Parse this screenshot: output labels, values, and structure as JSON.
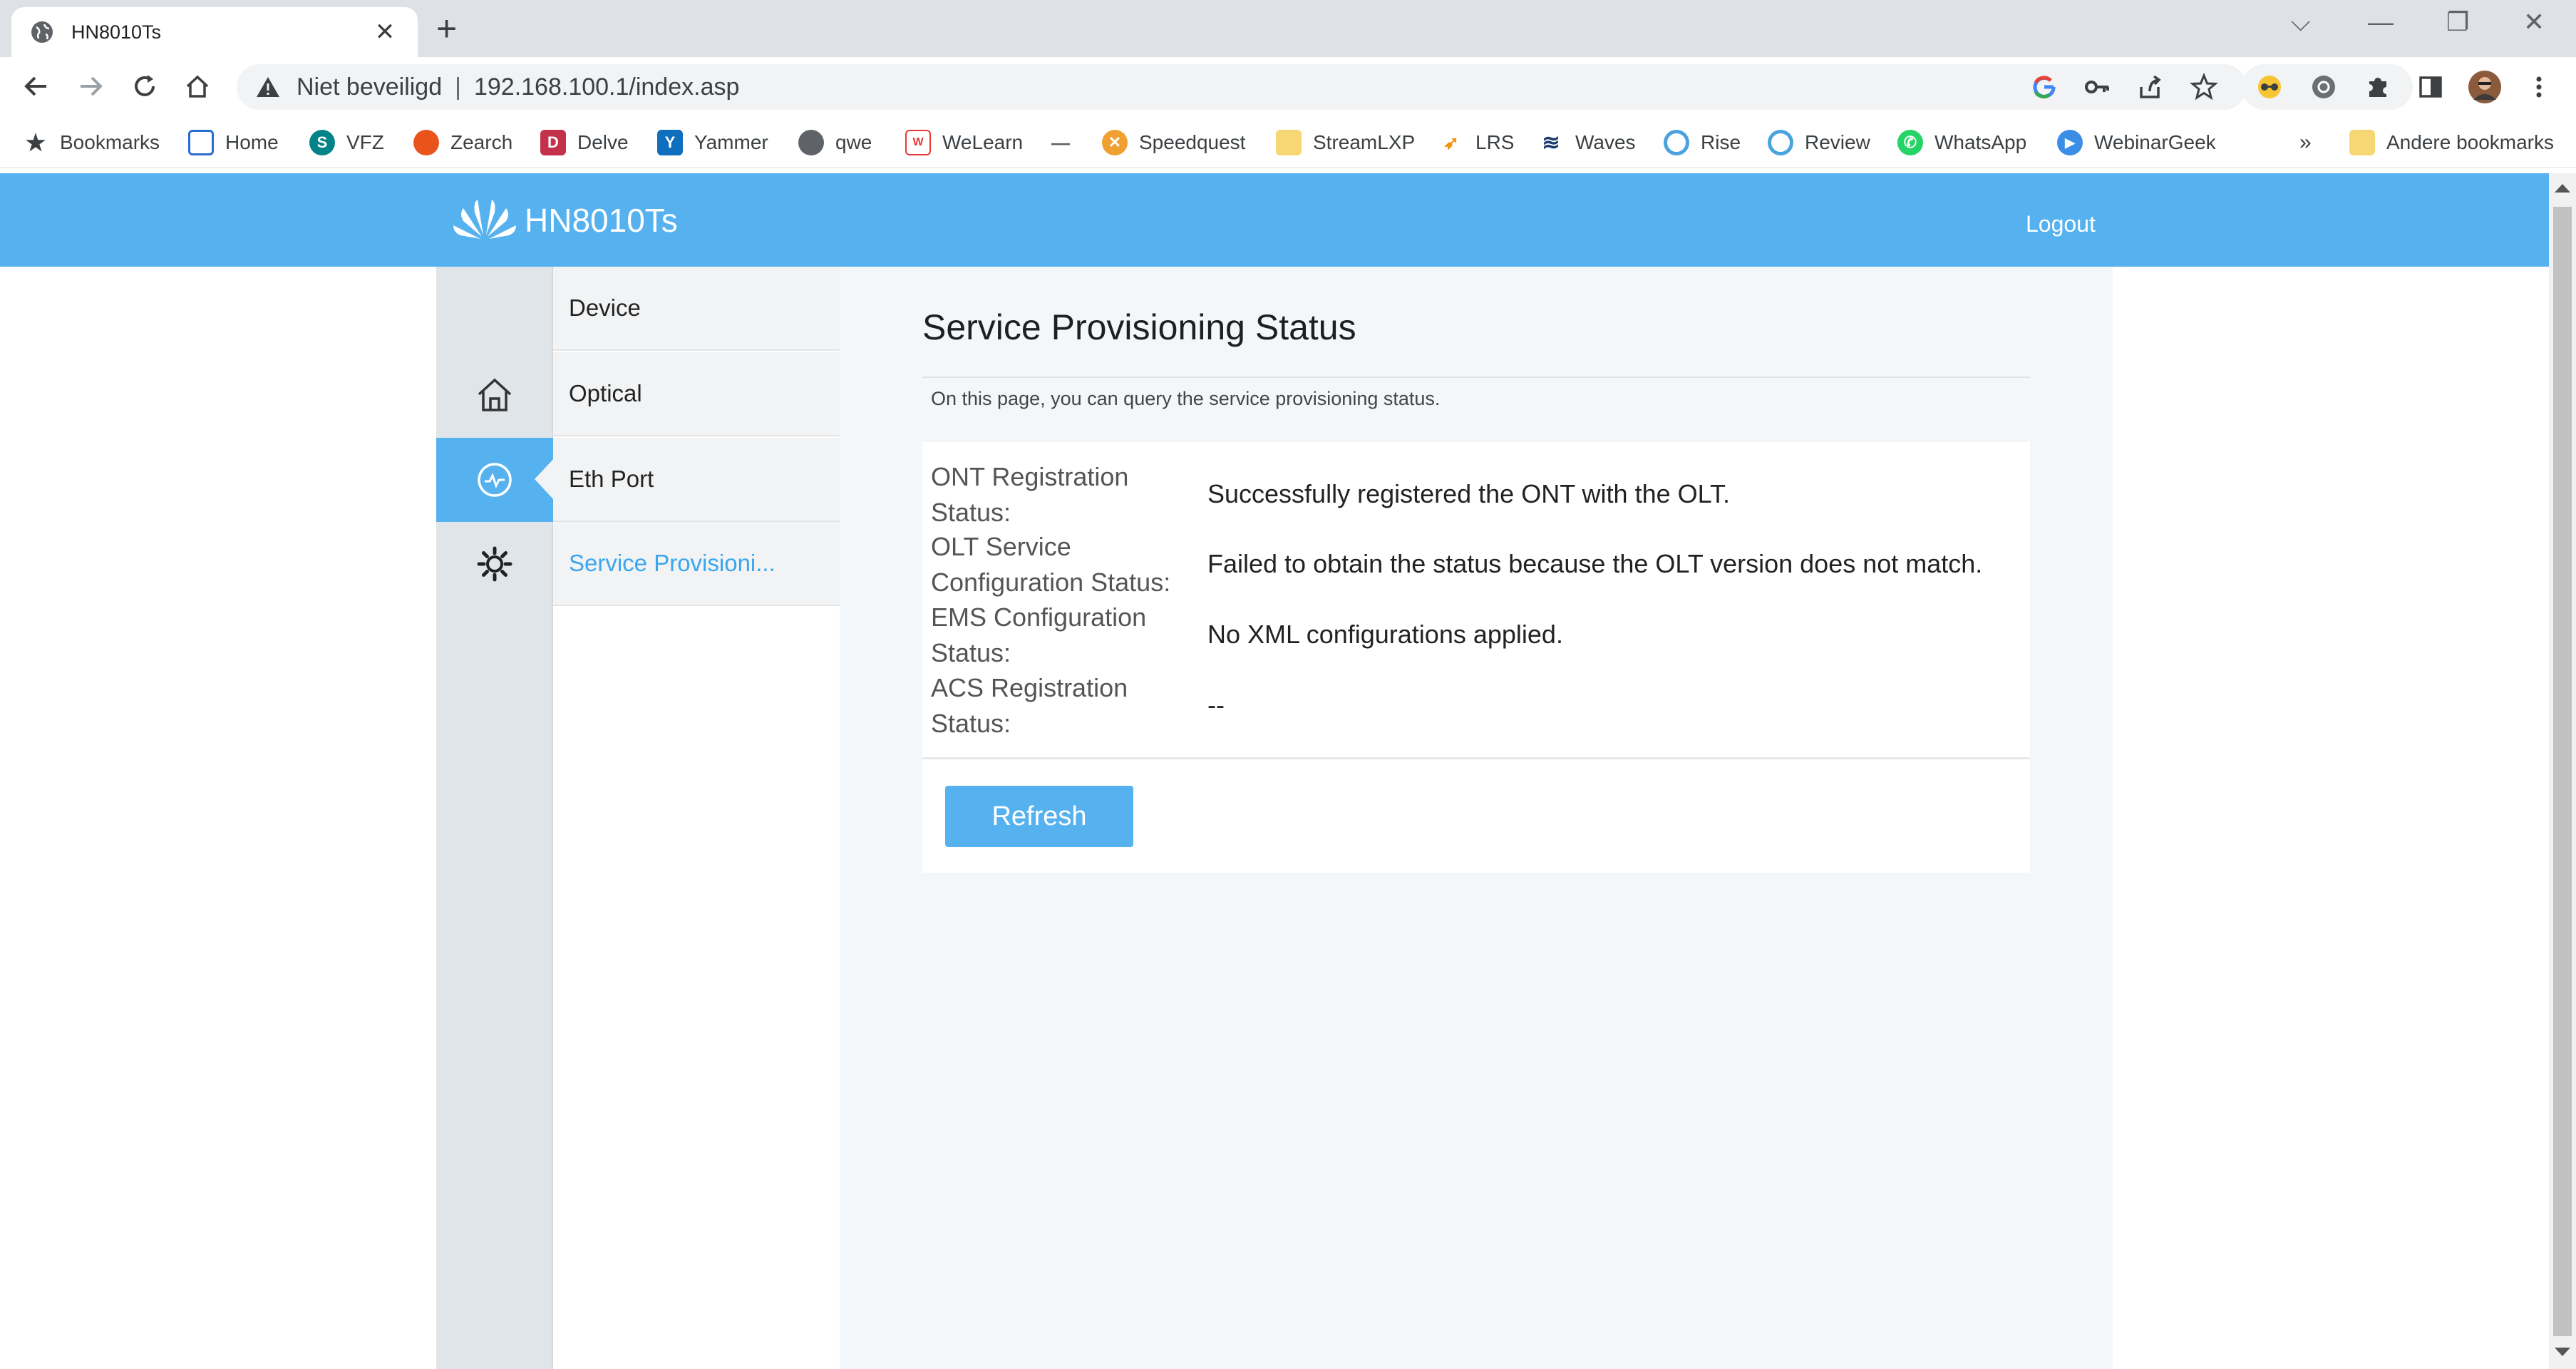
{
  "browser": {
    "tab_title": "HN8010Ts",
    "new_tab_label": "+",
    "address": {
      "security_text": "Niet beveiligd",
      "separator": "|",
      "url": "192.168.100.1/index.asp"
    },
    "bookmarks": [
      {
        "label": "Bookmarks",
        "icon": "star-icon"
      },
      {
        "label": "Home",
        "icon": "home-grid-icon"
      },
      {
        "label": "VFZ",
        "icon": "sharepoint-icon"
      },
      {
        "label": "Zearch",
        "icon": "zearch-icon"
      },
      {
        "label": "Delve",
        "icon": "delve-icon"
      },
      {
        "label": "Yammer",
        "icon": "yammer-icon"
      },
      {
        "label": "qwe",
        "icon": "globe-icon"
      },
      {
        "label": "WeLearn",
        "icon": "welearn-icon"
      },
      {
        "label": "Speedquest",
        "icon": "speedquest-icon"
      },
      {
        "label": "StreamLXP",
        "icon": "folder-icon"
      },
      {
        "label": "LRS",
        "icon": "lrs-icon"
      },
      {
        "label": "Waves",
        "icon": "waves-icon"
      },
      {
        "label": "Rise",
        "icon": "rise-icon"
      },
      {
        "label": "Review",
        "icon": "review-icon"
      },
      {
        "label": "WhatsApp",
        "icon": "whatsapp-icon"
      },
      {
        "label": "WebinarGeek",
        "icon": "webinargeek-icon"
      }
    ],
    "overflow_label": "»",
    "other_bookmarks": "Andere bookmarks"
  },
  "router": {
    "brand": "HN8010Ts",
    "logout": "Logout",
    "menu": [
      {
        "label": "Device"
      },
      {
        "label": "Optical"
      },
      {
        "label": "Eth Port"
      },
      {
        "label": "Service Provisioni..."
      }
    ],
    "page": {
      "title": "Service Provisioning Status",
      "description": "On this page, you can query the service provisioning status.",
      "rows": [
        {
          "label": "ONT Registration Status:",
          "value": "Successfully registered the ONT with the OLT."
        },
        {
          "label": "OLT Service Configuration Status:",
          "value": "Failed to obtain the status because the OLT version does not match."
        },
        {
          "label": "EMS Configuration Status:",
          "value": "No XML configurations applied."
        },
        {
          "label": "ACS Registration Status:",
          "value": "--"
        }
      ],
      "refresh_label": "Refresh"
    }
  },
  "colors": {
    "header": "#56b1ef",
    "active_menu_text": "#3aa6ee"
  }
}
